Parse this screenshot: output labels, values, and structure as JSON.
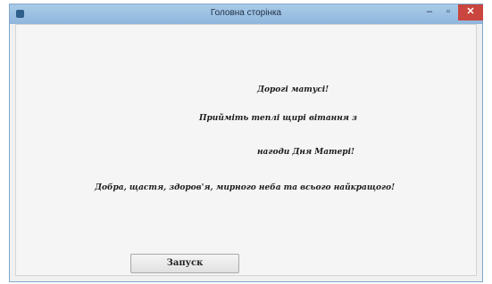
{
  "window": {
    "title": "Головна сторінка",
    "controls": {
      "minimize": "–",
      "maximize": "▫",
      "close": "✕"
    }
  },
  "messages": [
    "Дорогі матусі!",
    "Прийміть теплі щирі вітання з",
    "нагоди Дня Матері!",
    "Добра, щастя, здоров'я, мирного неба та всього найкращого!"
  ],
  "button": {
    "label": "Запуск"
  }
}
